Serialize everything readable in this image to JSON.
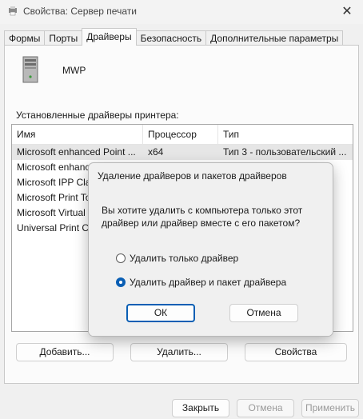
{
  "window": {
    "title": "Свойства: Сервер печати",
    "close_glyph": "✕"
  },
  "tabs": [
    {
      "label": "Формы"
    },
    {
      "label": "Порты"
    },
    {
      "label": "Драйверы"
    },
    {
      "label": "Безопасность"
    },
    {
      "label": "Дополнительные параметры"
    }
  ],
  "active_tab": "Драйверы",
  "server": {
    "name": "MWP"
  },
  "drivers": {
    "label": "Установленные драйверы принтера:",
    "columns": [
      "Имя",
      "Процессор",
      "Тип"
    ],
    "rows": [
      {
        "name": "Microsoft enhanced Point ...",
        "processor": "x64",
        "type": "Тип 3 - пользовательский ..."
      },
      {
        "name": "Microsoft enhanc",
        "processor": "",
        "type": ""
      },
      {
        "name": "Microsoft IPP Cla",
        "processor": "",
        "type": ""
      },
      {
        "name": "Microsoft Print To",
        "processor": "",
        "type": ""
      },
      {
        "name": "Microsoft Virtual",
        "processor": "",
        "type": ""
      },
      {
        "name": "Universal Print Cl",
        "processor": "",
        "type": ""
      }
    ]
  },
  "actions": {
    "add": "Добавить...",
    "remove": "Удалить...",
    "properties": "Свойства"
  },
  "footer": {
    "close": "Закрыть",
    "cancel": "Отмена",
    "apply": "Применить"
  },
  "dialog": {
    "title": "Удаление драйверов и пакетов драйверов",
    "question_line1": "Вы хотите удалить с компьютера только этот",
    "question_line2": "драйвер или драйвер вместе с его пакетом?",
    "option_driver_only": "Удалить только драйвер",
    "option_driver_package": "Удалить драйвер и пакет драйвера",
    "selected_option": "option_driver_package",
    "ok": "ОК",
    "cancel": "Отмена"
  },
  "colors": {
    "accent": "#0a5fb4",
    "window_bg": "#f0f0f0",
    "panel_bg": "#fbfbfb"
  }
}
